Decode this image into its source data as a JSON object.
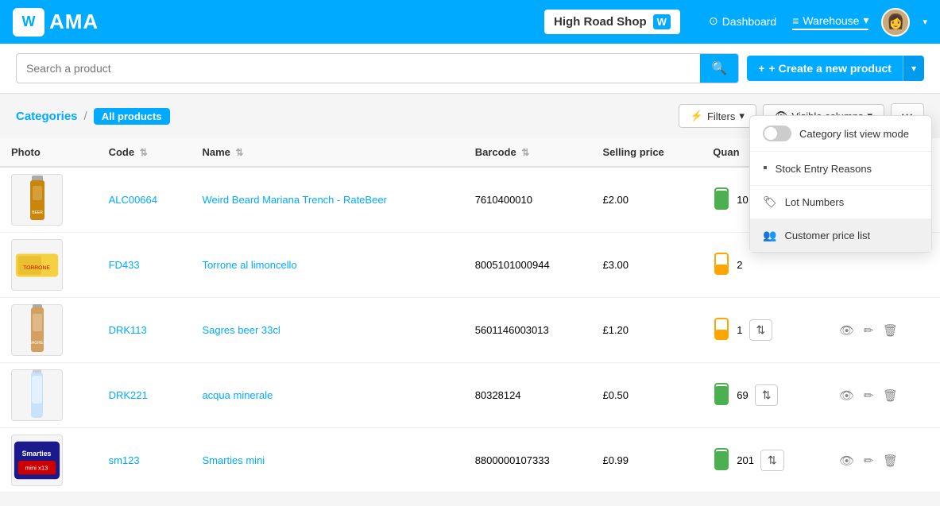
{
  "header": {
    "logo_text": "AMA",
    "logo_w": "W",
    "shop_name": "High Road Shop",
    "shop_icon": "W",
    "nav": [
      {
        "label": "Dashboard",
        "icon": "⊙",
        "active": false
      },
      {
        "label": "Warehouse",
        "icon": "≡",
        "active": true,
        "caret": "▾"
      }
    ],
    "avatar_emoji": "👩"
  },
  "toolbar": {
    "search_placeholder": "Search a product",
    "create_label": "+ Create a new product",
    "create_caret": "▾"
  },
  "categories": {
    "label": "Categories",
    "separator": "/",
    "active_badge": "All products",
    "filters_label": "Filters",
    "filters_caret": "▾",
    "visible_cols_label": "Visible columns",
    "visible_cols_caret": "▾",
    "more_icon": "···"
  },
  "table": {
    "columns": [
      {
        "key": "photo",
        "label": "Photo",
        "sortable": false
      },
      {
        "key": "code",
        "label": "Code",
        "sortable": true
      },
      {
        "key": "name",
        "label": "Name",
        "sortable": true
      },
      {
        "key": "barcode",
        "label": "Barcode",
        "sortable": true
      },
      {
        "key": "price",
        "label": "Selling price",
        "sortable": false
      },
      {
        "key": "qty",
        "label": "Quan",
        "sortable": false
      }
    ],
    "rows": [
      {
        "id": 1,
        "photo_emoji": "🍺",
        "code": "ALC00664",
        "name": "Weird Beard Mariana Trench - RateBeer",
        "barcode": "7610400010",
        "price": "£2.00",
        "qty": "10",
        "stock_level": "high",
        "show_actions": false
      },
      {
        "id": 2,
        "photo_emoji": "🍬",
        "code": "FD433",
        "name": "Torrone al limoncello",
        "barcode": "8005101000944",
        "price": "£3.00",
        "qty": "2",
        "stock_level": "low",
        "show_actions": false
      },
      {
        "id": 3,
        "photo_emoji": "🍺",
        "code": "DRK113",
        "name": "Sagres beer 33cl",
        "barcode": "5601146003013",
        "price": "£1.20",
        "qty": "1",
        "stock_level": "low",
        "show_actions": true
      },
      {
        "id": 4,
        "photo_emoji": "💧",
        "code": "DRK221",
        "name": "acqua minerale",
        "barcode": "80328124",
        "price": "£0.50",
        "qty": "69",
        "stock_level": "high",
        "show_actions": true
      },
      {
        "id": 5,
        "photo_emoji": "🍫",
        "code": "sm123",
        "name": "Smarties mini",
        "barcode": "8800000107333",
        "price": "£0.99",
        "qty": "201",
        "stock_level": "high",
        "show_actions": true
      }
    ]
  },
  "dropdown": {
    "items": [
      {
        "key": "category_view",
        "label": "Category list view mode",
        "type": "toggle",
        "icon": ""
      },
      {
        "key": "stock_entry",
        "label": "Stock Entry Reasons",
        "type": "icon",
        "icon": "▪"
      },
      {
        "key": "lot_numbers",
        "label": "Lot Numbers",
        "type": "icon",
        "icon": "🏷"
      },
      {
        "key": "customer_price",
        "label": "Customer price list",
        "type": "icon",
        "icon": "👥"
      }
    ]
  },
  "colors": {
    "brand": "#00aaff",
    "stock_high": "#4CAF50",
    "stock_low": "#FFA500",
    "link": "#00aaff"
  }
}
